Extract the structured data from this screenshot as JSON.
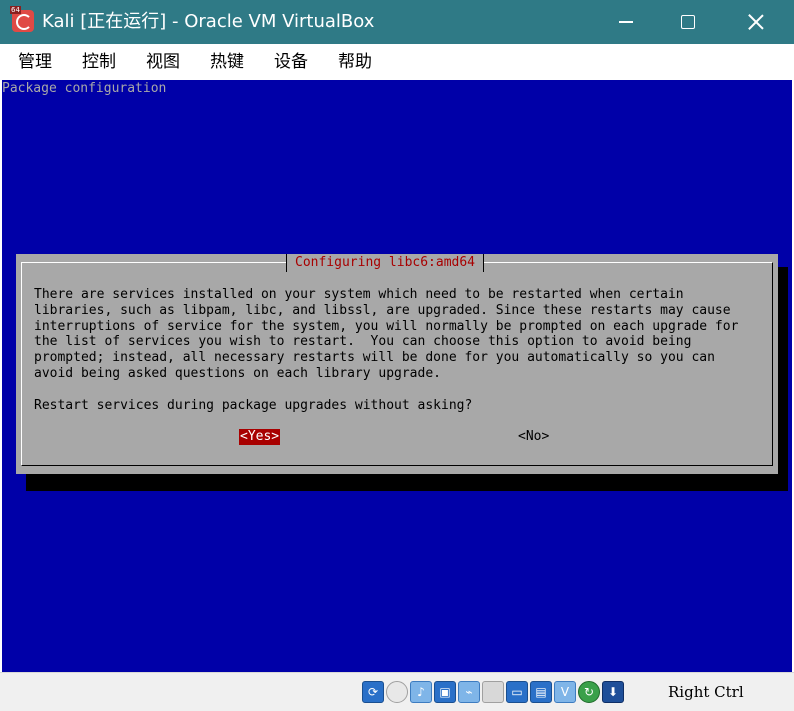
{
  "window": {
    "title": "Kali [正在运行] - Oracle VM VirtualBox",
    "icon_badge": "64"
  },
  "menu": {
    "items": [
      "管理",
      "控制",
      "视图",
      "热键",
      "设备",
      "帮助"
    ]
  },
  "screen": {
    "header": "Package configuration",
    "dialog": {
      "title": "Configuring libc6:amd64",
      "body": "There are services installed on your system which need to be restarted when certain\nlibraries, such as libpam, libc, and libssl, are upgraded. Since these restarts may cause\ninterruptions of service for the system, you will normally be prompted on each upgrade for\nthe list of services you wish to restart.  You can choose this option to avoid being\nprompted; instead, all necessary restarts will be done for you automatically so you can\navoid being asked questions on each library upgrade.",
      "question": "Restart services during package upgrades without asking?",
      "yes_label": "<Yes>",
      "no_label": "<No>"
    }
  },
  "statusbar": {
    "host_key": "Right Ctrl",
    "icons": [
      "hard-disk-icon",
      "optical-drive-icon",
      "audio-icon",
      "network-icon",
      "usb-icon",
      "shared-folders-icon",
      "display-icon",
      "video-capture-icon",
      "recording-icon",
      "cpu-virtualization-icon",
      "mouse-integration-icon",
      "host-key-icon"
    ]
  },
  "colors": {
    "titlebar": "#2f7a86",
    "screen_bg": "#0000a8",
    "dialog_bg": "#a8a8a8",
    "accent_red": "#a80000"
  }
}
